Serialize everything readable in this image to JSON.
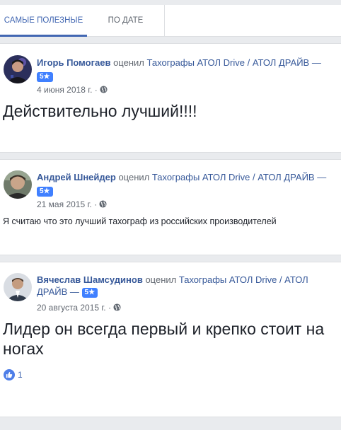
{
  "tabs": {
    "most_helpful": "САМЫЕ ПОЛЕЗНЫЕ",
    "by_date": "ПО ДАТЕ"
  },
  "reviews": [
    {
      "author": "Игорь Помогаев",
      "action": "оценил",
      "page": "Тахографы АТОЛ Drive / АТОЛ ДРАЙВ —",
      "rating": "5★",
      "date": "4 июня 2018 г.",
      "text": "Действительно лучший!!!!"
    },
    {
      "author": "Андрей Шнейдер",
      "action": "оценил",
      "page": "Тахографы АТОЛ Drive / АТОЛ ДРАЙВ —",
      "rating": "5★",
      "date": "21 мая 2015 г.",
      "text": "Я считаю что это лучший тахограф из российских производителей"
    },
    {
      "author": "Вячеслав Шамсудинов",
      "action": "оценил",
      "page": "Тахографы АТОЛ Drive / АТОЛ ДРАЙВ —",
      "rating": "5★",
      "date": "20 августа 2015 г.",
      "text": "Лидер он всегда первый и крепко стоит на ногах",
      "likes": "1"
    }
  ],
  "separator": "·",
  "colors": {
    "link": "#365899",
    "accent": "#4267b2",
    "badge": "#4080ff"
  }
}
